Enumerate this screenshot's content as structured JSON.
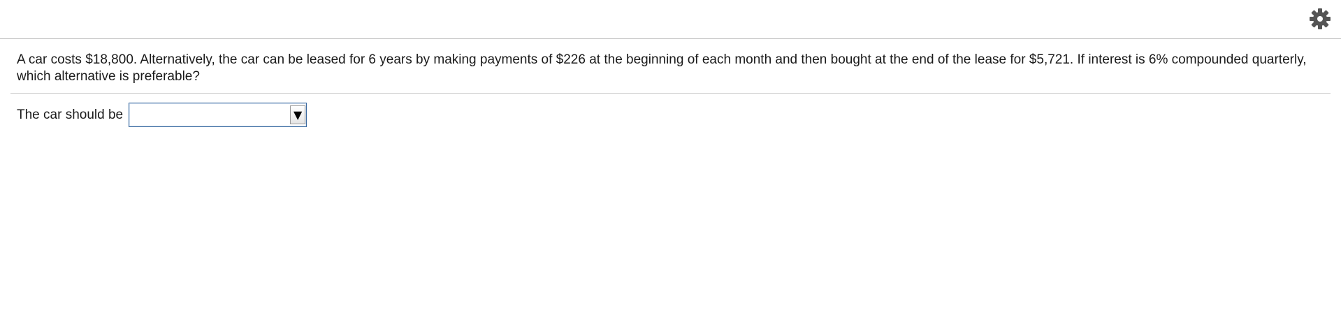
{
  "header": {
    "settings_icon": "gear-icon"
  },
  "question": {
    "text": "A car costs $18,800. Alternatively, the car can be leased for 6 years by making payments of $226 at the beginning of each month and then bought at the end of the lease for $5,721. If interest is 6% compounded quarterly, which alternative is preferable?"
  },
  "answer": {
    "label": "The car should be",
    "selected_value": "",
    "arrow_glyph": "▼"
  },
  "colors": {
    "dropdown_border": "#3b6aa0",
    "gear": "#555555"
  }
}
